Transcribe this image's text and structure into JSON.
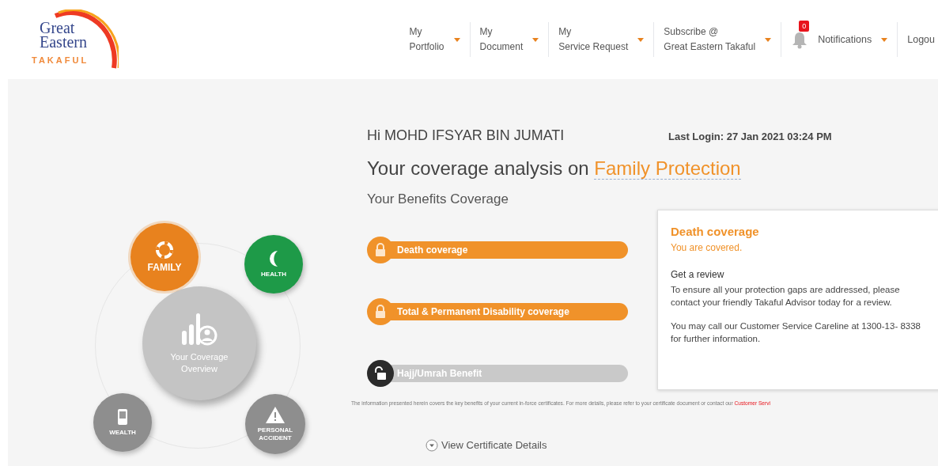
{
  "logo": {
    "line_1": "Great",
    "line_2": "Eastern",
    "line_3": "TAKAFUL"
  },
  "nav": [
    {
      "line_1": "My",
      "line_2": "Portfolio",
      "kind": "menu"
    },
    {
      "line_1": "My",
      "line_2": "Document",
      "kind": "menu"
    },
    {
      "line_1": "My",
      "line_2": "Service Request",
      "kind": "menu"
    },
    {
      "line_1": "Subscribe @",
      "line_2": "Great Eastern Takaful",
      "kind": "menu"
    },
    {
      "line_1": "Notifications",
      "badge": "0",
      "kind": "notifications"
    },
    {
      "line_1": "Logou",
      "kind": "link"
    }
  ],
  "wheel": {
    "center": "Your Coverage Overview",
    "items": [
      {
        "label": "FAMILY",
        "selected": true,
        "color": "#e8821e"
      },
      {
        "label": "HEALTH",
        "selected": false,
        "color": "#1e9a48"
      },
      {
        "label": "WEALTH",
        "selected": false,
        "color": "#8e8e8e"
      },
      {
        "label": "PERSONAL ACCIDENT",
        "selected": false,
        "color": "#8e8e8e"
      }
    ]
  },
  "greeting": "Hi MOHD IFSYAR BIN JUMATI",
  "last_login": "Last Login: 27 Jan 2021 03:24 PM",
  "heading": {
    "prefix": "Your coverage analysis on",
    "topic": "Family Protection"
  },
  "subheading": "Your Benefits Coverage",
  "benefits": [
    {
      "label": "Death coverage",
      "covered": true
    },
    {
      "label": "Total & Permanent Disability coverage",
      "covered": true
    },
    {
      "label": "Hajj/Umrah Benefit",
      "covered": false
    }
  ],
  "popup": {
    "title": "Death coverage",
    "status": "You are covered.",
    "subtitle": "Get a review",
    "paragraphs": [
      "To ensure all your protection gaps are addressed, please contact your friendly Takaful Advisor today for a review.",
      "You may call our Customer Service Careline at 1300-13- 8338 for further information."
    ]
  },
  "disclaimer": {
    "text": "The information presented herein covers the key benefits of your current in-force certificates. For more details, please refer to your certificate document or contact our",
    "link": "Customer Servi"
  },
  "details_link": "View Certificate Details"
}
